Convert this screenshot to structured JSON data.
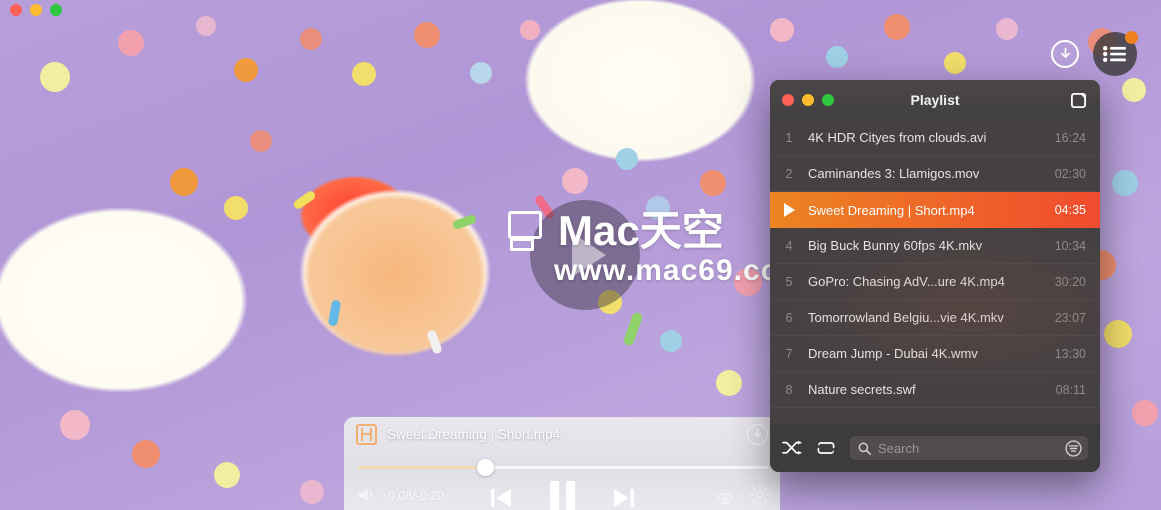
{
  "window": {
    "traffic_lights": [
      {
        "name": "close",
        "color": "#ff5f57"
      },
      {
        "name": "minimize",
        "color": "#febc2e"
      },
      {
        "name": "zoom",
        "color": "#2fc840"
      }
    ]
  },
  "video": {
    "watermark_text": "Mac天空",
    "watermark_url": "www.mac69.com"
  },
  "top_controls": {
    "download_icon": "download-circle-icon",
    "playlist_icon": "playlist-lines-icon",
    "badge_color": "#f0811a"
  },
  "player": {
    "file_icon": "film-icon",
    "title": "Sweet Dreaming | Short.mp4",
    "download_icon": "download-circle-icon",
    "progress_percent": 31,
    "time": "0:08/-0:20",
    "volume_icon": "volume-icon",
    "prev_label": "previous-track",
    "pause_label": "pause",
    "next_label": "next-track",
    "airplay_icon": "airplay-icon",
    "settings_icon": "gear-icon"
  },
  "playlist": {
    "title": "Playlist",
    "detach_icon": "detach-window-icon",
    "traffic_lights": [
      {
        "name": "close",
        "color": "#ff5f57"
      },
      {
        "name": "minimize",
        "color": "#febc2e"
      },
      {
        "name": "zoom",
        "color": "#2fc840"
      }
    ],
    "accent_start": "#ec8422",
    "accent_end": "#f04b2e",
    "items": [
      {
        "index": "1",
        "name": "4K HDR Cityes from clouds.avi",
        "duration": "16:24",
        "active": false
      },
      {
        "index": "2",
        "name": "Caminandes 3: Llamigos.mov",
        "duration": "02:30",
        "active": false
      },
      {
        "index": "3",
        "name": "Sweet Dreaming | Short.mp4",
        "duration": "04:35",
        "active": true
      },
      {
        "index": "4",
        "name": "Big Buck Bunny 60fps 4K.mkv",
        "duration": "10:34",
        "active": false
      },
      {
        "index": "5",
        "name": "GoPro: Chasing AdV...ure 4K.mp4",
        "duration": "30:20",
        "active": false
      },
      {
        "index": "6",
        "name": "Tomorrowland Belgiu...vie 4K.mkv",
        "duration": "23:07",
        "active": false
      },
      {
        "index": "7",
        "name": "Dream Jump - Dubai 4K.wmv",
        "duration": "13:30",
        "active": false
      },
      {
        "index": "8",
        "name": "Nature secrets.swf",
        "duration": "08:11",
        "active": false
      }
    ],
    "footer": {
      "shuffle_icon": "shuffle-icon",
      "repeat_icon": "repeat-icon",
      "search_icon": "search-icon",
      "search_placeholder": "Search",
      "search_value": "",
      "filter_icon": "filter-icon"
    }
  }
}
